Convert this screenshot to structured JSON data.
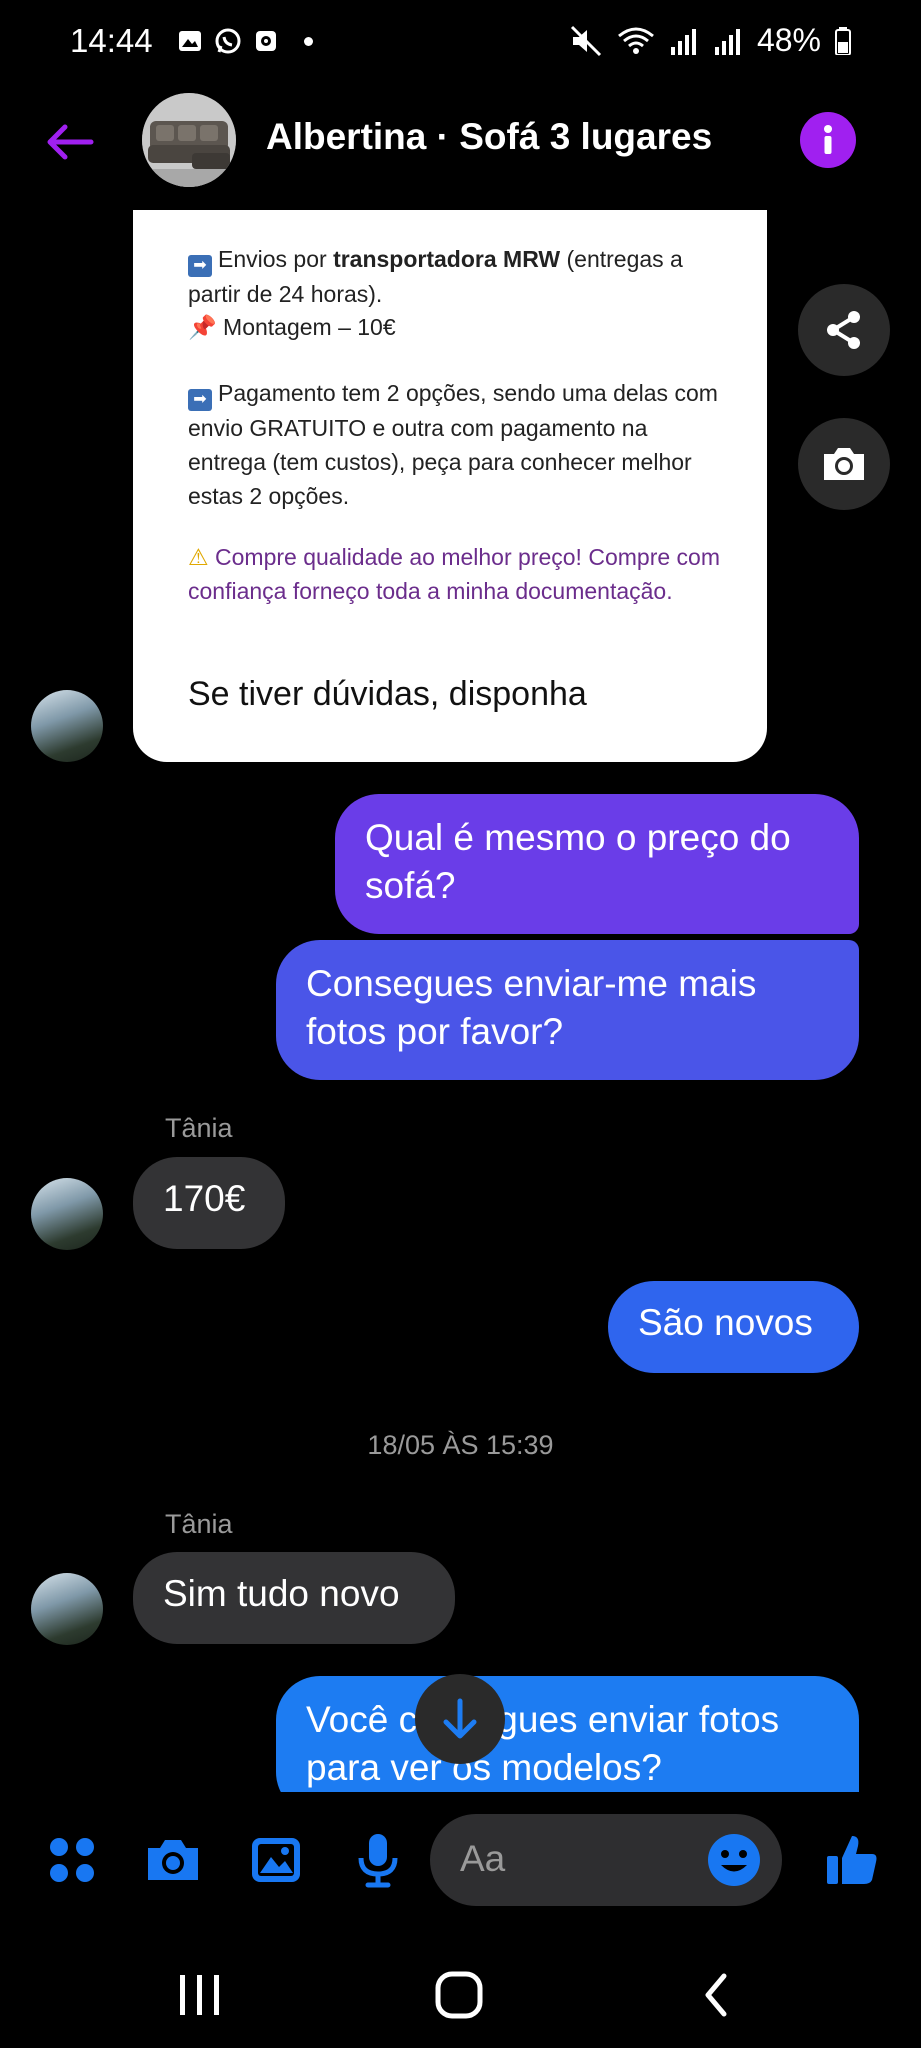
{
  "status_bar": {
    "time": "14:44",
    "battery": "48%"
  },
  "header": {
    "title": "Albertina · Sofá 3 lugares"
  },
  "shared_card": {
    "line1_a": "Envios por ",
    "line1_b": "transportadora MRW",
    "line1_c": " (entregas a partir de 24 horas).",
    "line2": "Montagem – 10€",
    "line3": "Pagamento tem 2 opções, sendo uma delas com envio GRATUITO e outra com pagamento na entrega (tem custos), peça para conhecer melhor estas 2 opções.",
    "line4": "Compre qualidade ao melhor preço! Compre com confiança forneço toda a minha documentação.",
    "line5": "Se tiver dúvidas, disponha"
  },
  "messages": {
    "out1": "Qual é mesmo o preço do sofá?",
    "out2": "Consegues enviar-me mais fotos por favor?",
    "sender1": "Tânia",
    "in1": "170€",
    "out3": "São novos",
    "date_separator": "18/05 ÀS 15:39",
    "sender2": "Tânia",
    "in2": "Sim tudo novo",
    "out4": "Você consegues enviar fotos para ver os modelos?"
  },
  "composer": {
    "placeholder": "Aa"
  },
  "colors": {
    "accent": "#a020f0",
    "blue": "#1877f2",
    "out_bubble_top": "#6a3de8",
    "out_bubble_mid": "#4a55e8",
    "out_bubble_bottom": "#1d7cf2"
  },
  "icons": [
    "back-arrow-icon",
    "info-icon",
    "share-icon",
    "camera-icon",
    "scroll-down-icon",
    "apps-icon",
    "photo-icon",
    "mic-icon",
    "emoji-icon",
    "thumbs-up-icon"
  ]
}
